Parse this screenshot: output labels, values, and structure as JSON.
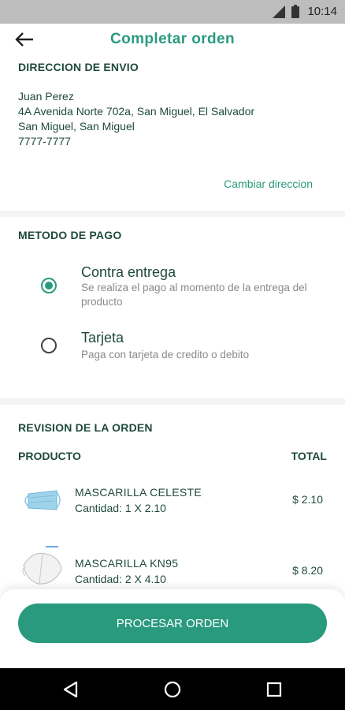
{
  "status_bar": {
    "time": "10:14"
  },
  "app_bar": {
    "title": "Completar orden"
  },
  "shipping": {
    "section_title": "DIRECCION DE ENVIO",
    "name": "Juan Perez",
    "address_line": "4A Avenida Norte 702a, San Miguel, El Salvador",
    "city": "San Miguel, San Miguel",
    "phone": "7777-7777",
    "change_link": "Cambiar direccion"
  },
  "payment": {
    "section_title": "METODO DE PAGO",
    "options": [
      {
        "name": "Contra entrega",
        "description": "Se realiza el pago al momento de la entrega del producto",
        "selected": true
      },
      {
        "name": "Tarjeta",
        "description": "Paga con tarjeta de credito o debito",
        "selected": false
      }
    ]
  },
  "review": {
    "section_title": "REVISION DE LA ORDEN",
    "col_product": "PRODUCTO",
    "col_total": "TOTAL",
    "items": [
      {
        "name": "MASCARILLA CELESTE",
        "quantity": "Cantidad: 1 X 2.10",
        "price": "$ 2.10",
        "image": "blue-surgical-mask"
      },
      {
        "name": "MASCARILLA KN95",
        "quantity": "Cantidad: 2 X 4.10",
        "price": "$ 8.20",
        "image": "white-kn95-mask"
      }
    ]
  },
  "footer": {
    "process_button": "PROCESAR ORDEN"
  },
  "colors": {
    "accent": "#2a9a7e",
    "text_dark": "#1f4a3a",
    "muted": "#8a8a8a",
    "background": "#f4f4f4"
  }
}
